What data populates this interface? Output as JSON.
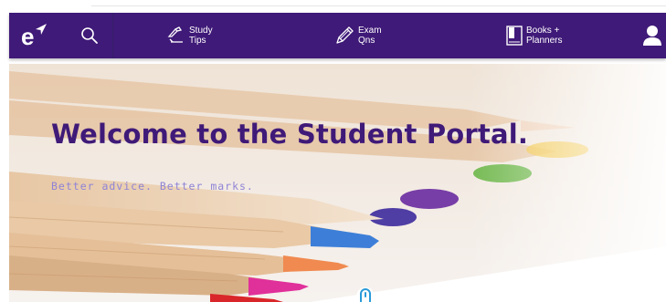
{
  "nav": {
    "logo_letter": "e",
    "items": [
      {
        "label_line1": "Study",
        "label_line2": "Tips",
        "icon": "study-tips-icon"
      },
      {
        "label_line1": "Exam",
        "label_line2": "Qns",
        "icon": "pencil-icon"
      },
      {
        "label_line1": "Books +",
        "label_line2": "Planners",
        "icon": "book-icon"
      }
    ],
    "icons": {
      "search": "search-icon",
      "user": "user-icon"
    }
  },
  "hero": {
    "title": "Welcome to the Student Portal.",
    "subtitle": "Better advice. Better marks."
  },
  "colors": {
    "brand": "#3f1a78",
    "subtitle": "#8f83d6",
    "scroll_indicator": "#2a9ad8"
  }
}
